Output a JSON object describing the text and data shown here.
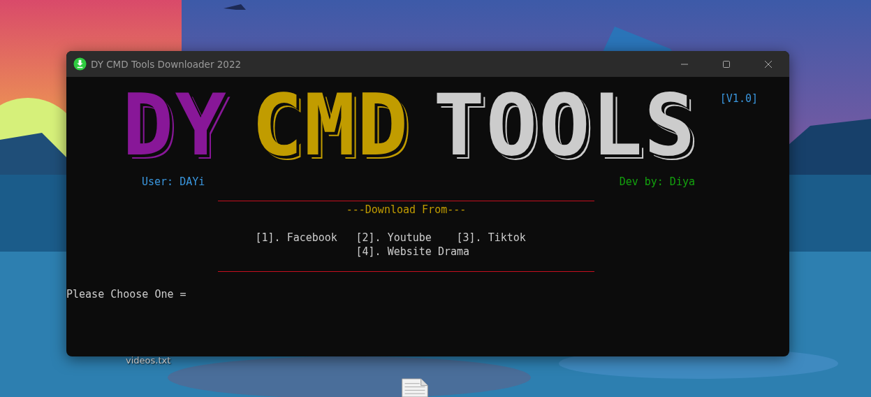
{
  "window": {
    "title": "DY CMD Tools Downloader 2022"
  },
  "banner": {
    "words": [
      {
        "text": "DY",
        "color": "#881798"
      },
      {
        "text": "CMD",
        "color": "#c19c00"
      },
      {
        "text": "TOOLS",
        "color": "#cccccc"
      }
    ],
    "version": "[V1.0]"
  },
  "user": "User: DAYi",
  "dev": "Dev by: Diya",
  "menu": {
    "heading": "---Download From---",
    "rows": [
      [
        "[1]. Facebook",
        "[2]. Youtube",
        "[3]. Tiktok"
      ],
      [
        "",
        "[4]. Website Drama"
      ]
    ]
  },
  "prompt": "Please Choose One =",
  "desktop": {
    "file_label": "videos.txt"
  }
}
